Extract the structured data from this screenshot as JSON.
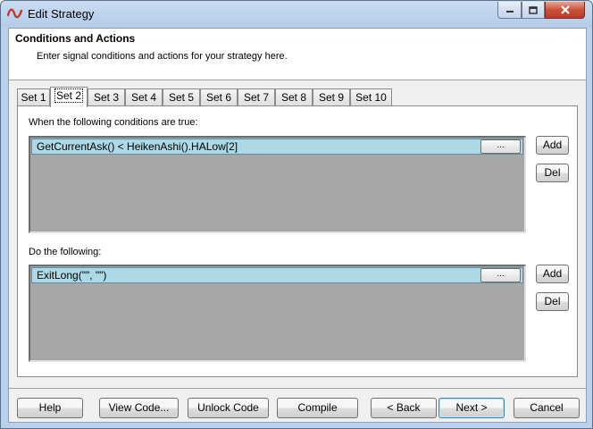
{
  "window": {
    "title": "Edit Strategy",
    "colors": {
      "frame": "#b9d1ea",
      "close": "#c7533b",
      "row_selected": "#add8e6",
      "list_bg": "#a7a7a7"
    }
  },
  "header": {
    "title": "Conditions and Actions",
    "subtitle": "Enter signal conditions and actions for your strategy here."
  },
  "tabs": [
    {
      "label": "Set 1"
    },
    {
      "label": "Set 2",
      "active": true
    },
    {
      "label": "Set 3"
    },
    {
      "label": "Set 4"
    },
    {
      "label": "Set 5"
    },
    {
      "label": "Set 6"
    },
    {
      "label": "Set 7"
    },
    {
      "label": "Set 8"
    },
    {
      "label": "Set 9"
    },
    {
      "label": "Set 10"
    }
  ],
  "conditions": {
    "label": "When the following conditions are true:",
    "items": [
      {
        "text": "GetCurrentAsk() < HeikenAshi().HALow[2]",
        "button": "..."
      }
    ],
    "add_label": "Add",
    "del_label": "Del"
  },
  "actions": {
    "label": "Do the following:",
    "items": [
      {
        "text": "ExitLong(\"\", \"\")",
        "button": "..."
      }
    ],
    "add_label": "Add",
    "del_label": "Del"
  },
  "footer": {
    "help": "Help",
    "view_code": "View Code...",
    "unlock_code": "Unlock Code",
    "compile": "Compile",
    "back": "< Back",
    "next": "Next >",
    "cancel": "Cancel"
  },
  "icons": {
    "app": "app-logo-icon",
    "minimize": "minimize-icon",
    "maximize": "maximize-icon",
    "close": "close-icon"
  }
}
